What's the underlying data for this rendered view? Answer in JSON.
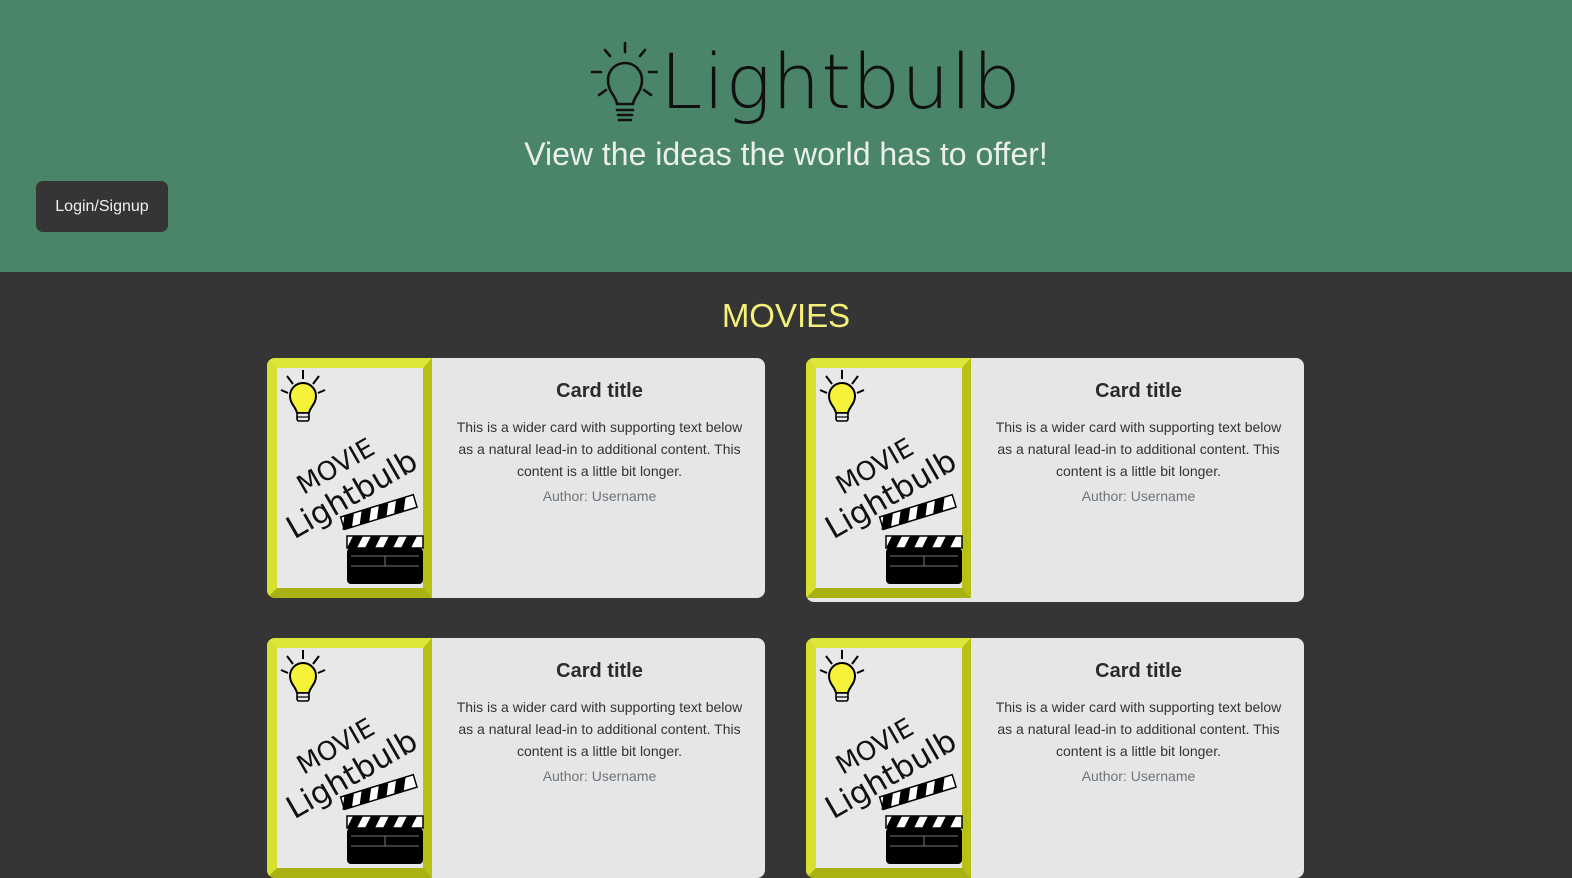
{
  "header": {
    "logo_text": "Lightbulb",
    "tagline": "View the ideas the world has to offer!",
    "login_label": "Login/Signup",
    "background_color": "#4a856a"
  },
  "section": {
    "title": "MOVIES",
    "title_color": "#f4f07a"
  },
  "poster": {
    "line1": "MOVIE",
    "line2": "Lightbulb",
    "frame_color": "#c9d41c",
    "bulb_color": "#f6f23a"
  },
  "cards": [
    {
      "title": "Card title",
      "text": "This is a wider card with supporting text below as a natural lead-in to additional content. This content is a little bit longer.",
      "author": "Author: Username"
    },
    {
      "title": "Card title",
      "text": "This is a wider card with supporting text below as a natural lead-in to additional content. This content is a little bit longer.",
      "author": "Author: Username"
    },
    {
      "title": "Card title",
      "text": "This is a wider card with supporting text below as a natural lead-in to additional content. This content is a little bit longer.",
      "author": "Author: Username"
    },
    {
      "title": "Card title",
      "text": "This is a wider card with supporting text below as a natural lead-in to additional content. This content is a little bit longer.",
      "author": "Author: Username"
    }
  ]
}
